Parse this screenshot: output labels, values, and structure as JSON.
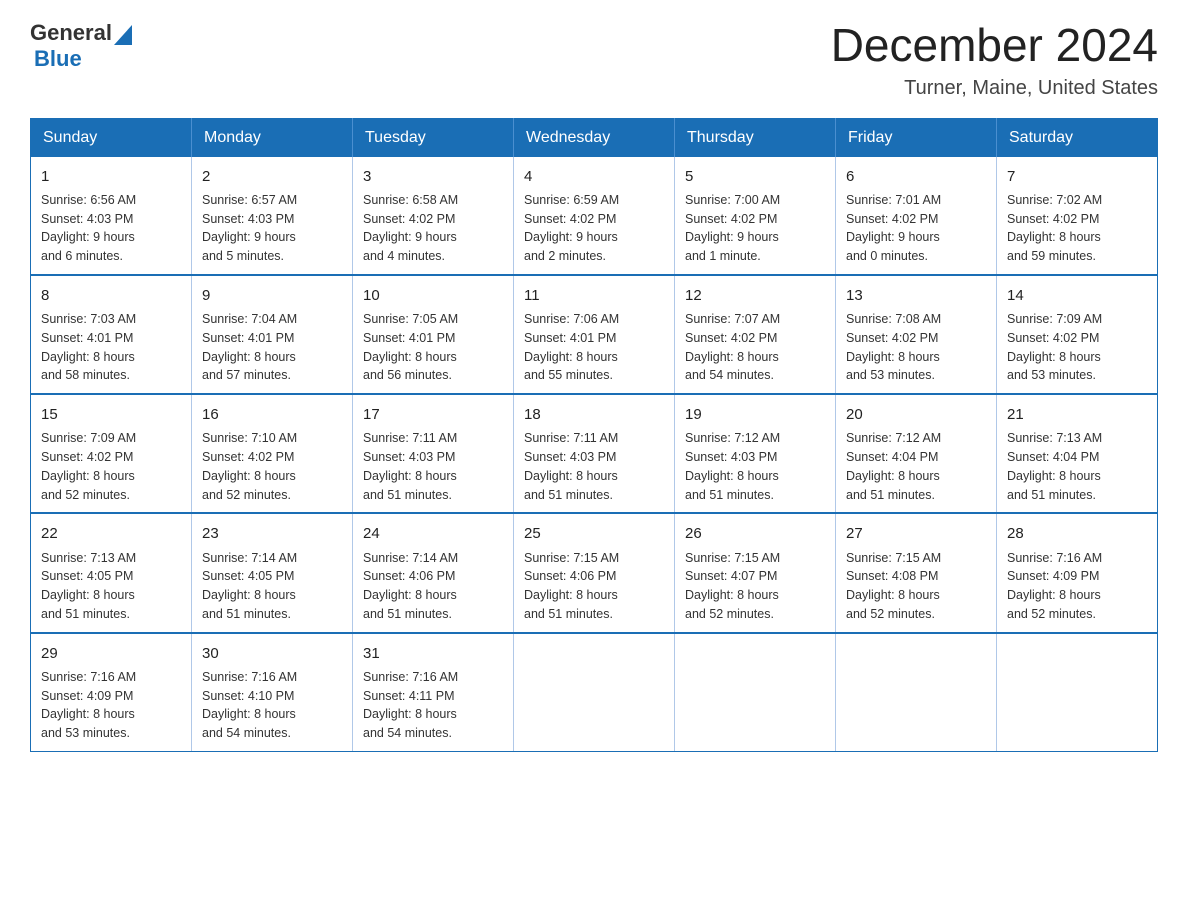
{
  "header": {
    "logo_general": "General",
    "logo_blue": "Blue",
    "month_title": "December 2024",
    "location": "Turner, Maine, United States"
  },
  "weekdays": [
    "Sunday",
    "Monday",
    "Tuesday",
    "Wednesday",
    "Thursday",
    "Friday",
    "Saturday"
  ],
  "weeks": [
    [
      {
        "day": "1",
        "info": "Sunrise: 6:56 AM\nSunset: 4:03 PM\nDaylight: 9 hours\nand 6 minutes."
      },
      {
        "day": "2",
        "info": "Sunrise: 6:57 AM\nSunset: 4:03 PM\nDaylight: 9 hours\nand 5 minutes."
      },
      {
        "day": "3",
        "info": "Sunrise: 6:58 AM\nSunset: 4:02 PM\nDaylight: 9 hours\nand 4 minutes."
      },
      {
        "day": "4",
        "info": "Sunrise: 6:59 AM\nSunset: 4:02 PM\nDaylight: 9 hours\nand 2 minutes."
      },
      {
        "day": "5",
        "info": "Sunrise: 7:00 AM\nSunset: 4:02 PM\nDaylight: 9 hours\nand 1 minute."
      },
      {
        "day": "6",
        "info": "Sunrise: 7:01 AM\nSunset: 4:02 PM\nDaylight: 9 hours\nand 0 minutes."
      },
      {
        "day": "7",
        "info": "Sunrise: 7:02 AM\nSunset: 4:02 PM\nDaylight: 8 hours\nand 59 minutes."
      }
    ],
    [
      {
        "day": "8",
        "info": "Sunrise: 7:03 AM\nSunset: 4:01 PM\nDaylight: 8 hours\nand 58 minutes."
      },
      {
        "day": "9",
        "info": "Sunrise: 7:04 AM\nSunset: 4:01 PM\nDaylight: 8 hours\nand 57 minutes."
      },
      {
        "day": "10",
        "info": "Sunrise: 7:05 AM\nSunset: 4:01 PM\nDaylight: 8 hours\nand 56 minutes."
      },
      {
        "day": "11",
        "info": "Sunrise: 7:06 AM\nSunset: 4:01 PM\nDaylight: 8 hours\nand 55 minutes."
      },
      {
        "day": "12",
        "info": "Sunrise: 7:07 AM\nSunset: 4:02 PM\nDaylight: 8 hours\nand 54 minutes."
      },
      {
        "day": "13",
        "info": "Sunrise: 7:08 AM\nSunset: 4:02 PM\nDaylight: 8 hours\nand 53 minutes."
      },
      {
        "day": "14",
        "info": "Sunrise: 7:09 AM\nSunset: 4:02 PM\nDaylight: 8 hours\nand 53 minutes."
      }
    ],
    [
      {
        "day": "15",
        "info": "Sunrise: 7:09 AM\nSunset: 4:02 PM\nDaylight: 8 hours\nand 52 minutes."
      },
      {
        "day": "16",
        "info": "Sunrise: 7:10 AM\nSunset: 4:02 PM\nDaylight: 8 hours\nand 52 minutes."
      },
      {
        "day": "17",
        "info": "Sunrise: 7:11 AM\nSunset: 4:03 PM\nDaylight: 8 hours\nand 51 minutes."
      },
      {
        "day": "18",
        "info": "Sunrise: 7:11 AM\nSunset: 4:03 PM\nDaylight: 8 hours\nand 51 minutes."
      },
      {
        "day": "19",
        "info": "Sunrise: 7:12 AM\nSunset: 4:03 PM\nDaylight: 8 hours\nand 51 minutes."
      },
      {
        "day": "20",
        "info": "Sunrise: 7:12 AM\nSunset: 4:04 PM\nDaylight: 8 hours\nand 51 minutes."
      },
      {
        "day": "21",
        "info": "Sunrise: 7:13 AM\nSunset: 4:04 PM\nDaylight: 8 hours\nand 51 minutes."
      }
    ],
    [
      {
        "day": "22",
        "info": "Sunrise: 7:13 AM\nSunset: 4:05 PM\nDaylight: 8 hours\nand 51 minutes."
      },
      {
        "day": "23",
        "info": "Sunrise: 7:14 AM\nSunset: 4:05 PM\nDaylight: 8 hours\nand 51 minutes."
      },
      {
        "day": "24",
        "info": "Sunrise: 7:14 AM\nSunset: 4:06 PM\nDaylight: 8 hours\nand 51 minutes."
      },
      {
        "day": "25",
        "info": "Sunrise: 7:15 AM\nSunset: 4:06 PM\nDaylight: 8 hours\nand 51 minutes."
      },
      {
        "day": "26",
        "info": "Sunrise: 7:15 AM\nSunset: 4:07 PM\nDaylight: 8 hours\nand 52 minutes."
      },
      {
        "day": "27",
        "info": "Sunrise: 7:15 AM\nSunset: 4:08 PM\nDaylight: 8 hours\nand 52 minutes."
      },
      {
        "day": "28",
        "info": "Sunrise: 7:16 AM\nSunset: 4:09 PM\nDaylight: 8 hours\nand 52 minutes."
      }
    ],
    [
      {
        "day": "29",
        "info": "Sunrise: 7:16 AM\nSunset: 4:09 PM\nDaylight: 8 hours\nand 53 minutes."
      },
      {
        "day": "30",
        "info": "Sunrise: 7:16 AM\nSunset: 4:10 PM\nDaylight: 8 hours\nand 54 minutes."
      },
      {
        "day": "31",
        "info": "Sunrise: 7:16 AM\nSunset: 4:11 PM\nDaylight: 8 hours\nand 54 minutes."
      },
      {
        "day": "",
        "info": ""
      },
      {
        "day": "",
        "info": ""
      },
      {
        "day": "",
        "info": ""
      },
      {
        "day": "",
        "info": ""
      }
    ]
  ]
}
